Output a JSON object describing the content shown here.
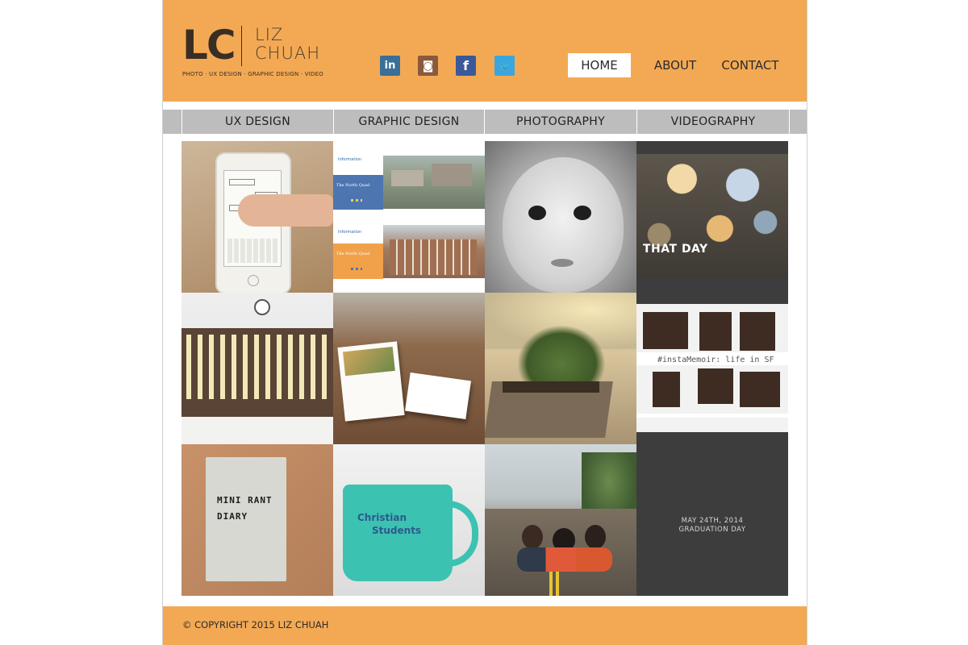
{
  "logo": {
    "monogram": "LC",
    "name_line1": "LIZ",
    "name_line2": "CHUAH",
    "tagline": "PHOTO · UX DESIGN · GRAPHIC DESIGN · VIDEO"
  },
  "social": [
    {
      "name": "linkedin",
      "glyph": "in",
      "color": "#3a6f97"
    },
    {
      "name": "instagram",
      "glyph": "◙",
      "color": "#8a5a3c"
    },
    {
      "name": "facebook",
      "glyph": "f",
      "color": "#3b5998"
    },
    {
      "name": "twitter",
      "glyph": "🐦",
      "color": "#3aa6dd"
    }
  ],
  "nav": {
    "home": "HOME",
    "about": "ABOUT",
    "contact": "CONTACT"
  },
  "categories": {
    "ux": "UX DESIGN",
    "graphic": "GRAPHIC DESIGN",
    "photo": "PHOTOGRAPHY",
    "video": "VIDEOGRAPHY"
  },
  "tiles": {
    "that_day_title": "THAT DAY",
    "memoir_caption": "#instaMemoir: life in SF",
    "graduation_line1": "MAY 24TH, 2014",
    "graduation_line2": "GRADUATION DAY",
    "notebook_text": "MINI RANT DIARY",
    "mug_line1": "Christian",
    "mug_line2": "Students",
    "brochure_label": "The North Quad"
  },
  "footer": {
    "copyright": "© COPYRIGHT 2015 LIZ CHUAH"
  }
}
